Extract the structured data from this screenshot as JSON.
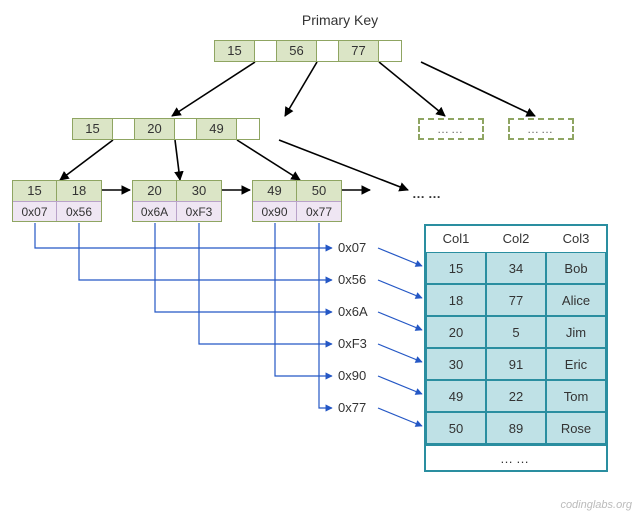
{
  "title": "Primary Key",
  "root": {
    "keys": [
      "15",
      "56",
      "77"
    ]
  },
  "mid": {
    "keys": [
      "15",
      "20",
      "49"
    ]
  },
  "ghost_label": "……",
  "leaves": [
    {
      "keys": [
        "15",
        "18"
      ],
      "values": [
        "0x07",
        "0x56"
      ]
    },
    {
      "keys": [
        "20",
        "30"
      ],
      "values": [
        "0x6A",
        "0xF3"
      ]
    },
    {
      "keys": [
        "49",
        "50"
      ],
      "values": [
        "0x90",
        "0x77"
      ]
    }
  ],
  "leaf_ellipsis": "……",
  "pointers": [
    "0x07",
    "0x56",
    "0x6A",
    "0xF3",
    "0x90",
    "0x77"
  ],
  "table": {
    "headers": [
      "Col1",
      "Col2",
      "Col3"
    ],
    "rows": [
      [
        "15",
        "34",
        "Bob"
      ],
      [
        "18",
        "77",
        "Alice"
      ],
      [
        "20",
        "5",
        "Jim"
      ],
      [
        "30",
        "91",
        "Eric"
      ],
      [
        "49",
        "22",
        "Tom"
      ],
      [
        "50",
        "89",
        "Rose"
      ]
    ],
    "footer": "……"
  },
  "watermark": "codinglabs.org",
  "chart_data": {
    "type": "table",
    "title": "B+Tree primary-key index pointing into a clustered table",
    "btree": {
      "root_keys": [
        15,
        56,
        77
      ],
      "internal_keys": [
        15,
        20,
        49
      ],
      "leaves": [
        {
          "keys": [
            15,
            18
          ],
          "row_pointers": [
            "0x07",
            "0x56"
          ]
        },
        {
          "keys": [
            20,
            30
          ],
          "row_pointers": [
            "0x6A",
            "0xF3"
          ]
        },
        {
          "keys": [
            49,
            50
          ],
          "row_pointers": [
            "0x90",
            "0x77"
          ]
        }
      ]
    },
    "pointer_to_row": {
      "0x07": {
        "Col1": 15,
        "Col2": 34,
        "Col3": "Bob"
      },
      "0x56": {
        "Col1": 18,
        "Col2": 77,
        "Col3": "Alice"
      },
      "0x6A": {
        "Col1": 20,
        "Col2": 5,
        "Col3": "Jim"
      },
      "0xF3": {
        "Col1": 30,
        "Col2": 91,
        "Col3": "Eric"
      },
      "0x90": {
        "Col1": 49,
        "Col2": 22,
        "Col3": "Tom"
      },
      "0x77": {
        "Col1": 50,
        "Col2": 89,
        "Col3": "Rose"
      }
    },
    "columns": [
      "Col1",
      "Col2",
      "Col3"
    ]
  }
}
